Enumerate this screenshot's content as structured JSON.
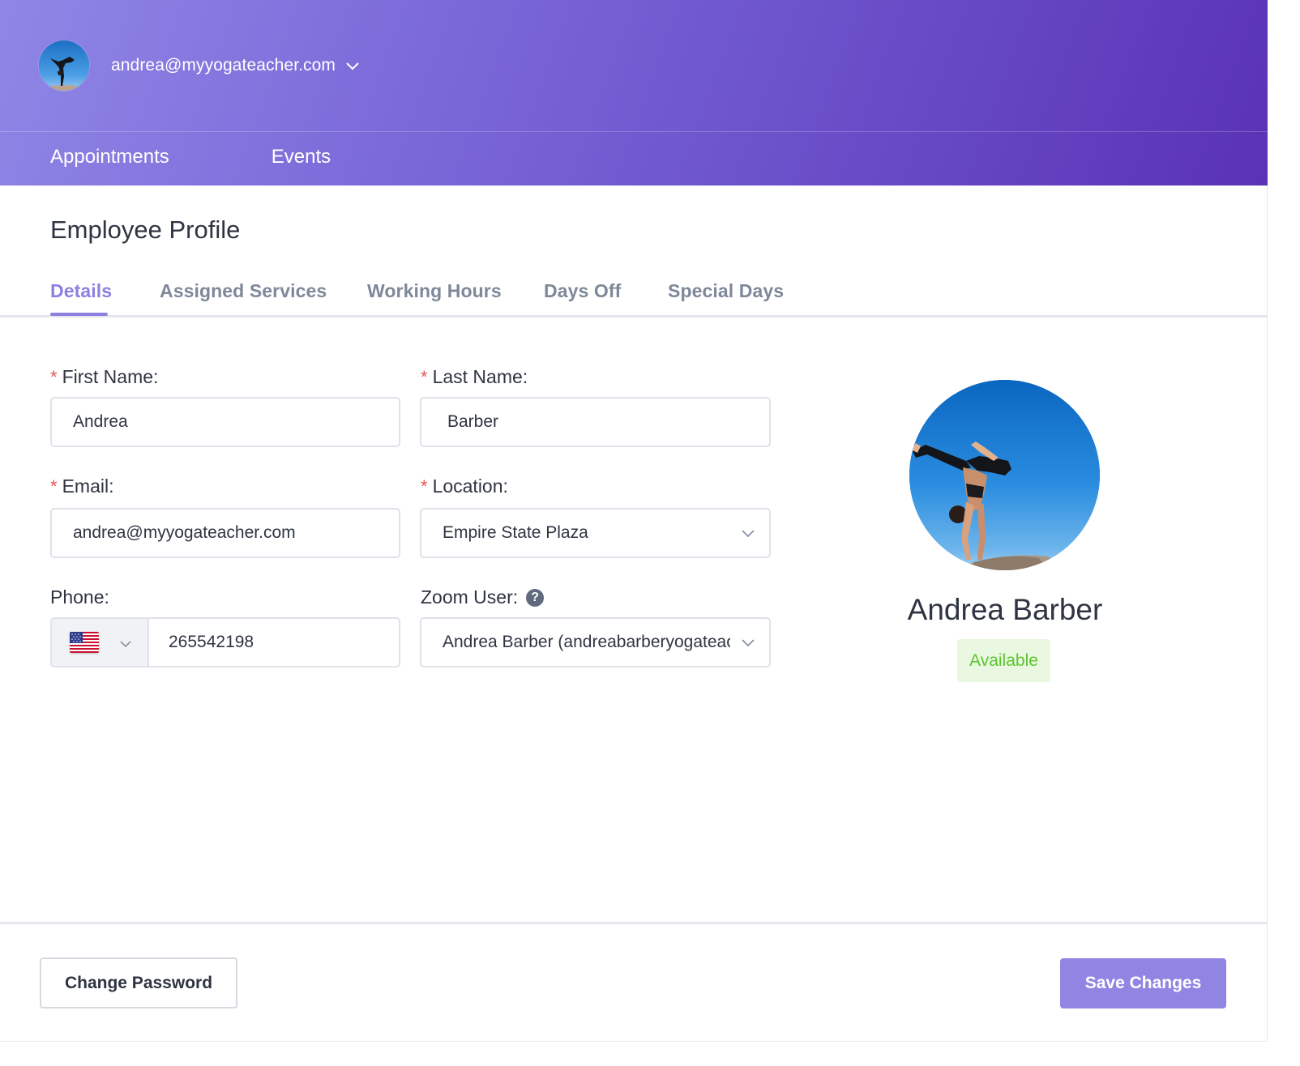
{
  "header": {
    "user_email": "andrea@myyogateacher.com",
    "nav": [
      {
        "label": "Appointments"
      },
      {
        "label": "Events"
      }
    ]
  },
  "page": {
    "title": "Employee Profile",
    "tabs": [
      {
        "label": "Details",
        "active": true
      },
      {
        "label": "Assigned Services",
        "active": false
      },
      {
        "label": "Working Hours",
        "active": false
      },
      {
        "label": "Days Off",
        "active": false
      },
      {
        "label": "Special Days",
        "active": false
      }
    ]
  },
  "form": {
    "required_mark": "*",
    "first_name": {
      "label": "First Name:",
      "value": "Andrea"
    },
    "last_name": {
      "label": "Last Name:",
      "value": "Barber"
    },
    "email": {
      "label": "Email:",
      "value": "andrea@myyogateacher.com"
    },
    "location": {
      "label": "Location:",
      "value": "Empire State Plaza"
    },
    "phone": {
      "label": "Phone:",
      "country": "United States",
      "value": "265542198"
    },
    "zoom_user": {
      "label": "Zoom User:",
      "help": "?",
      "value": "Andrea Barber (andreabarberyogateacher"
    }
  },
  "profile": {
    "name": "Andrea Barber",
    "status": "Available"
  },
  "footer": {
    "change_password": "Change Password",
    "save_changes": "Save Changes"
  },
  "colors": {
    "accent": "#8b80e0",
    "primary_button": "#9185e3",
    "header_gradient_start": "#8f86e6",
    "header_gradient_end": "#5a32b5",
    "required": "#e25555",
    "status_text": "#5bc52e",
    "status_bg": "#eaf8e2"
  },
  "icons": {
    "user_menu": "chevron-down-icon",
    "select": "chevron-down-icon",
    "help": "question-circle-icon",
    "country_flag": "us-flag-icon"
  }
}
